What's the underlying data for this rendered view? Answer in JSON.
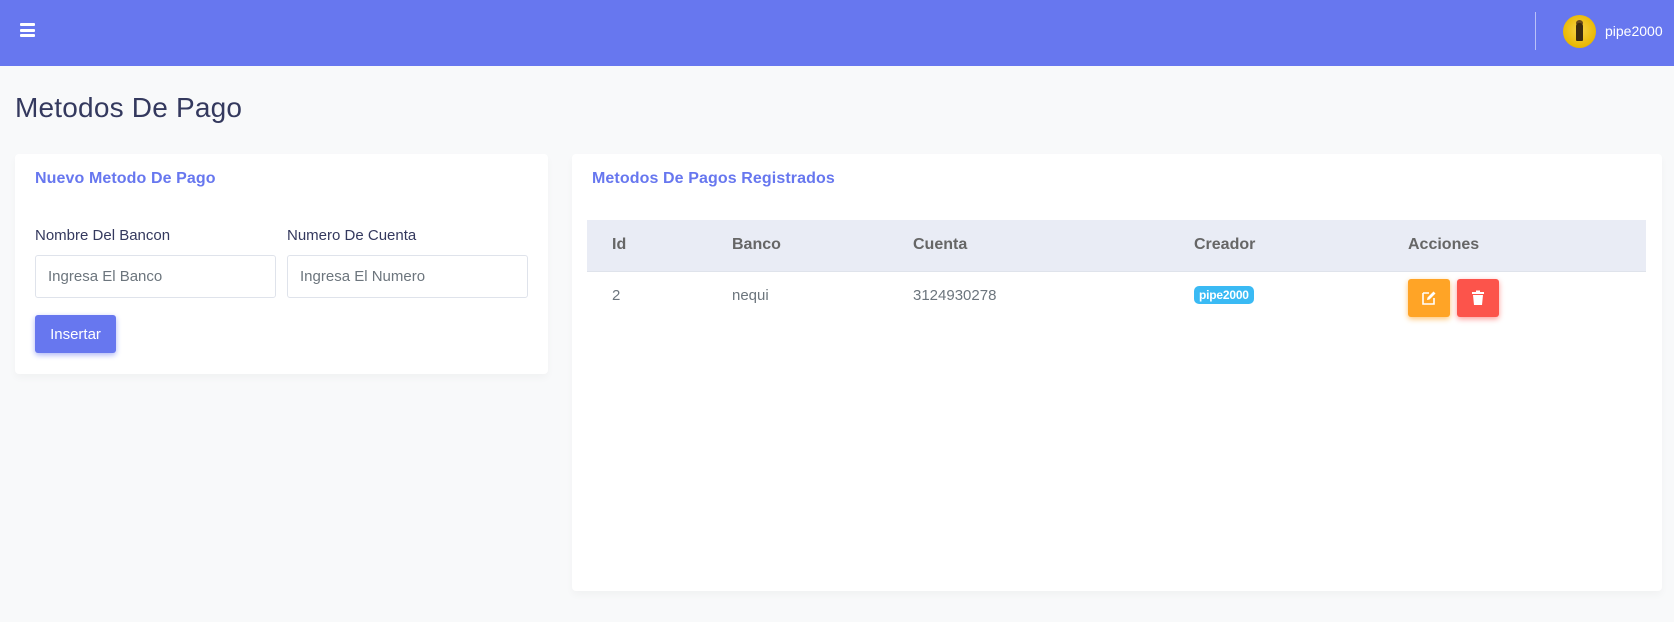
{
  "navbar": {
    "username": "pipe2000",
    "accent_color": "#6777ef"
  },
  "page": {
    "title": "Metodos De Pago"
  },
  "form_card": {
    "header": "Nuevo Metodo De Pago",
    "bank_label": "Nombre Del Bancon",
    "bank_placeholder": "Ingresa El Banco",
    "bank_value": "",
    "account_label": "Numero De Cuenta",
    "account_placeholder": "Ingresa El Numero",
    "account_value": "",
    "submit_label": "Insertar"
  },
  "table_card": {
    "header": "Metodos De Pagos Registrados",
    "columns": [
      "Id",
      "Banco",
      "Cuenta",
      "Creador",
      "Acciones"
    ],
    "rows": [
      {
        "id": "2",
        "banco": "nequi",
        "cuenta": "3124930278",
        "creador": "pipe2000"
      }
    ],
    "colors": {
      "badge": "#3abaf4",
      "edit": "#ffa426",
      "delete": "#fc544b"
    },
    "icons": {
      "edit": "edit-icon",
      "delete": "trash-icon"
    }
  }
}
